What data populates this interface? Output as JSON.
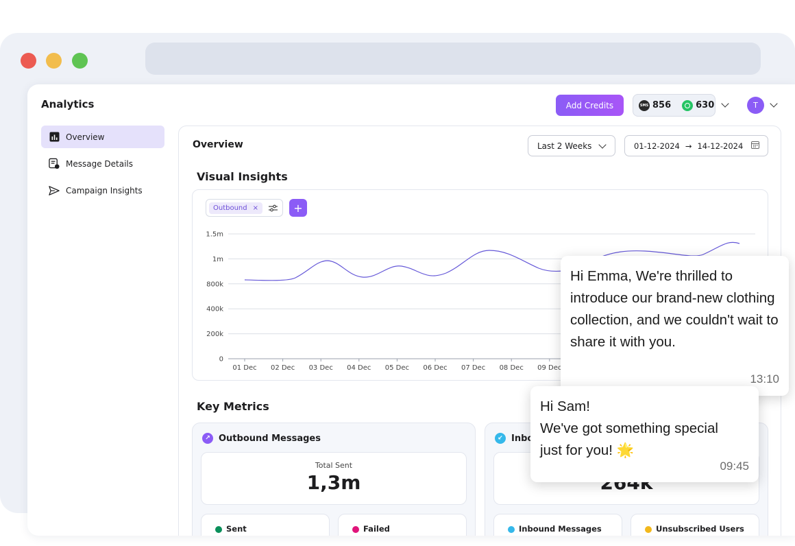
{
  "app": {
    "title": "Analytics",
    "add_credits": "Add Credits",
    "sms_badge": "SMS",
    "sms_credits": "856",
    "whatsapp_credits": "630",
    "avatar_initial": "T"
  },
  "sidebar": {
    "items": [
      {
        "label": "Overview",
        "icon": "bar-chart-icon",
        "active": true
      },
      {
        "label": "Message Details",
        "icon": "message-doc-icon",
        "active": false
      },
      {
        "label": "Campaign Insights",
        "icon": "send-icon",
        "active": false
      }
    ]
  },
  "main": {
    "title": "Overview",
    "period_select": "Last 2 Weeks",
    "date_from": "01-12-2024",
    "date_arrow": "→",
    "date_to": "14-12-2024"
  },
  "visual_insights": {
    "title": "Visual Insights",
    "filter_chip": "Outbound",
    "filter_remove": "×",
    "add_label": "+"
  },
  "chart_data": {
    "type": "line",
    "title": "",
    "xlabel": "",
    "ylabel": "",
    "y_ticks": [
      "1.5m",
      "1m",
      "800k",
      "400k",
      "200k",
      "0"
    ],
    "x_ticks": [
      "01 Dec",
      "02 Dec",
      "03 Dec",
      "04 Dec",
      "05 Dec",
      "06 Dec",
      "07 Dec",
      "08 Dec",
      "09 Dec"
    ],
    "grid": true,
    "color": "#6558d8"
  },
  "key_metrics": {
    "title": "Key Metrics",
    "outbound": {
      "title": "Outbound Messages",
      "total_label": "Total Sent",
      "total_value": "1,3m",
      "sent_label": "Sent",
      "failed_label": "Failed"
    },
    "inbound": {
      "title": "Inbound Messages",
      "total_value": "264k",
      "inbound_label": "Inbound Messages",
      "unsub_label": "Unsubscribed Users"
    }
  },
  "messages": [
    {
      "text": "Hi Emma, We're thrilled to introduce our brand-new clothing collection, and we couldn't wait to share it with you.",
      "time": "13:10"
    },
    {
      "line1": "Hi Sam!",
      "line2": "We've got something special",
      "line3": "just for you! 🌟",
      "time": "09:45"
    }
  ],
  "colors": {
    "accent": "#8b5cf6",
    "sent": "#0a8f5a",
    "failed": "#e0147a",
    "inbound": "#35b8ea",
    "unsubscribed": "#f2b81c"
  }
}
